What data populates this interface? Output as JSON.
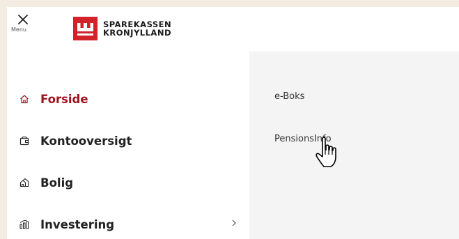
{
  "header": {
    "menu_label": "Menu",
    "logo_line1": "SPAREKASSEN",
    "logo_line2": "KRONJYLLAND",
    "brand_color": "#d2232a"
  },
  "nav": {
    "items": [
      {
        "label": "Forside",
        "icon": "home-icon",
        "active": true
      },
      {
        "label": "Kontooversigt",
        "icon": "wallet-icon",
        "active": false
      },
      {
        "label": "Bolig",
        "icon": "house-icon",
        "active": false
      },
      {
        "label": "Investering",
        "icon": "chart-bars-icon",
        "active": false,
        "has_submenu": true
      }
    ],
    "active_color": "#a1111d"
  },
  "submenu": {
    "items": [
      {
        "label": "e-Boks"
      },
      {
        "label": "PensionsInfo"
      }
    ]
  }
}
